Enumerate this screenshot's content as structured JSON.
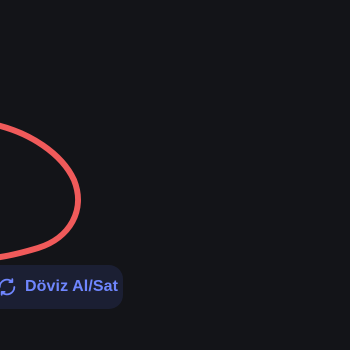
{
  "screen": {
    "background_color": "#131418"
  },
  "annotation": {
    "type": "hand-drawn-circle",
    "color": "#f05a5a"
  },
  "action_button": {
    "label": "Döviz Al/Sat",
    "icon": "exchange-arrows-icon",
    "text_color": "#6f86ff",
    "background_color": "#1b1f33"
  }
}
